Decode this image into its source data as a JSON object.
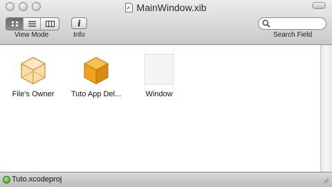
{
  "window": {
    "title": "MainWindow.xib"
  },
  "toolbar": {
    "view_mode_label": "View Mode",
    "info_label": "Info",
    "search_label": "Search Field",
    "search_placeholder": "",
    "view_modes": [
      "icon-view",
      "list-view",
      "column-view"
    ],
    "selected_view_mode": "icon-view"
  },
  "objects": [
    {
      "label": "File's Owner",
      "icon": "files-owner-cube-icon"
    },
    {
      "label": "Tuto App Del...",
      "icon": "app-delegate-cube-icon"
    },
    {
      "label": "Window",
      "icon": "window-icon"
    }
  ],
  "status": {
    "project": "Tuto.xcodeproj",
    "indicator_color": "#3fae2a"
  },
  "colors": {
    "cube_orange": "#f0a020",
    "cube_light": "#f8c878"
  }
}
